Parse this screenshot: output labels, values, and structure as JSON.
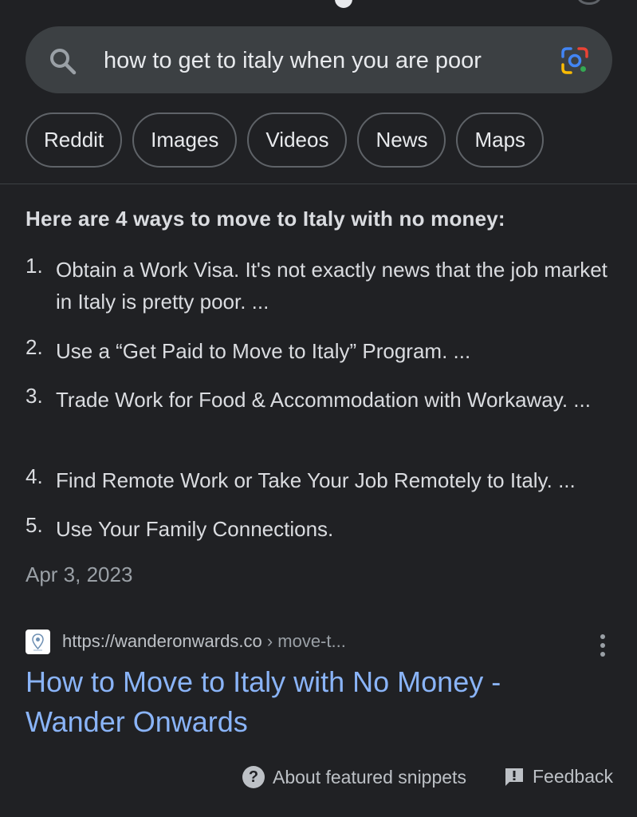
{
  "search": {
    "query": "how to get to italy when you are poor"
  },
  "chips": [
    "Reddit",
    "Images",
    "Videos",
    "News",
    "Maps"
  ],
  "snippet": {
    "heading": "Here are 4 ways to move to Italy with no money:",
    "items": [
      {
        "num": "1.",
        "text": "Obtain a Work Visa. It's not exactly news that the job market in Italy is pretty poor. ..."
      },
      {
        "num": "2.",
        "text": "Use a “Get Paid to Move to Italy” Program. ..."
      },
      {
        "num": "3.",
        "text": "Trade Work for Food & Accommodation with Workaway. ..."
      },
      {
        "num": "4.",
        "text": "Find Remote Work or Take Your Job Remotely to Italy. ..."
      },
      {
        "num": "5.",
        "text": "Use Your Family Connections."
      }
    ],
    "date": "Apr 3, 2023"
  },
  "source": {
    "url": "https://wanderonwards.co",
    "path": " › move-t...",
    "title": "How to Move to Italy with No Money - Wander Onwards"
  },
  "footer": {
    "about": "About featured snippets",
    "feedback": "Feedback"
  },
  "colors": {
    "background": "#202124",
    "link": "#8ab4f8",
    "search_bar": "#3c4043"
  },
  "icons": [
    "search-icon",
    "google-lens-icon",
    "more-vert-icon",
    "help-icon",
    "feedback-icon",
    "site-favicon"
  ]
}
